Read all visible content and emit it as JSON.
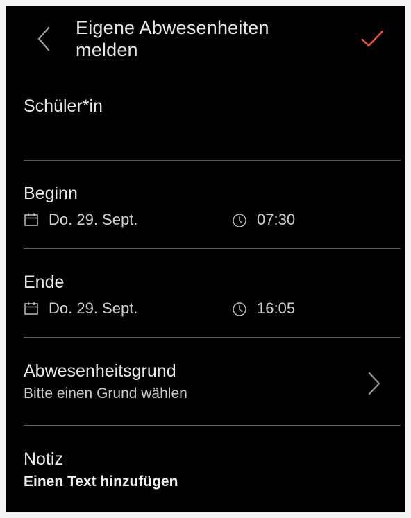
{
  "header": {
    "title_line1": "Eigene Abwesenheiten",
    "title_line2": "melden",
    "back_icon": "chevron-left-icon",
    "confirm_icon": "checkmark-icon",
    "accent_color": "#e8553e"
  },
  "student": {
    "label": "Schüler*in",
    "value": ""
  },
  "begin": {
    "label": "Beginn",
    "date": "Do. 29. Sept.",
    "time": "07:30"
  },
  "end": {
    "label": "Ende",
    "date": "Do. 29. Sept.",
    "time": "16:05"
  },
  "reason": {
    "label": "Abwesenheitsgrund",
    "placeholder": "Bitte einen Grund wählen"
  },
  "note": {
    "label": "Notiz",
    "placeholder": "Einen Text hinzufügen"
  }
}
